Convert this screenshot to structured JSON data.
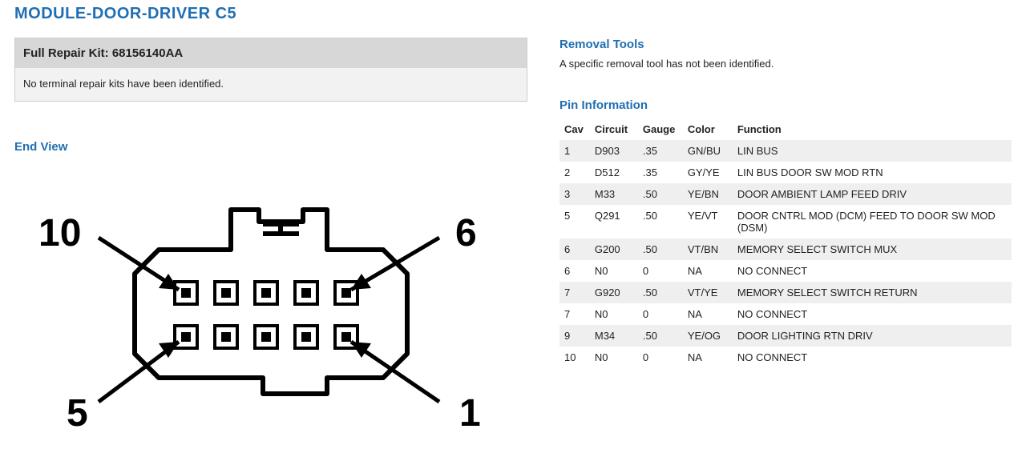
{
  "title": "MODULE-DOOR-DRIVER C5",
  "left": {
    "kit_header_prefix": "Full Repair Kit: ",
    "kit_number": "68156140AA",
    "kit_body": "No terminal repair kits have been identified.",
    "endview_heading": "End View",
    "connector_labels": {
      "tl": "10",
      "tr": "6",
      "bl": "5",
      "br": "1"
    }
  },
  "right": {
    "removal_heading": "Removal Tools",
    "removal_note": "A specific removal tool has not been identified.",
    "pin_heading": "Pin Information",
    "columns": {
      "cav": "Cav",
      "circuit": "Circuit",
      "gauge": "Gauge",
      "color": "Color",
      "function": "Function"
    },
    "rows": [
      {
        "cav": "1",
        "circuit": "D903",
        "gauge": ".35",
        "color": "GN/BU",
        "function": "LIN BUS"
      },
      {
        "cav": "2",
        "circuit": "D512",
        "gauge": ".35",
        "color": "GY/YE",
        "function": "LIN BUS DOOR SW MOD RTN"
      },
      {
        "cav": "3",
        "circuit": "M33",
        "gauge": ".50",
        "color": "YE/BN",
        "function": "DOOR AMBIENT LAMP FEED DRIV"
      },
      {
        "cav": "5",
        "circuit": "Q291",
        "gauge": ".50",
        "color": "YE/VT",
        "function": "DOOR CNTRL MOD (DCM) FEED TO DOOR SW MOD (DSM)"
      },
      {
        "cav": "6",
        "circuit": "G200",
        "gauge": ".50",
        "color": "VT/BN",
        "function": "MEMORY SELECT SWITCH MUX"
      },
      {
        "cav": "6",
        "circuit": "N0",
        "gauge": "0",
        "color": "NA",
        "function": "NO CONNECT"
      },
      {
        "cav": "7",
        "circuit": "G920",
        "gauge": ".50",
        "color": "VT/YE",
        "function": "MEMORY SELECT SWITCH RETURN"
      },
      {
        "cav": "7",
        "circuit": "N0",
        "gauge": "0",
        "color": "NA",
        "function": "NO CONNECT"
      },
      {
        "cav": "9",
        "circuit": "M34",
        "gauge": ".50",
        "color": "YE/OG",
        "function": "DOOR LIGHTING RTN DRIV"
      },
      {
        "cav": "10",
        "circuit": "N0",
        "gauge": "0",
        "color": "NA",
        "function": "NO CONNECT"
      }
    ]
  }
}
